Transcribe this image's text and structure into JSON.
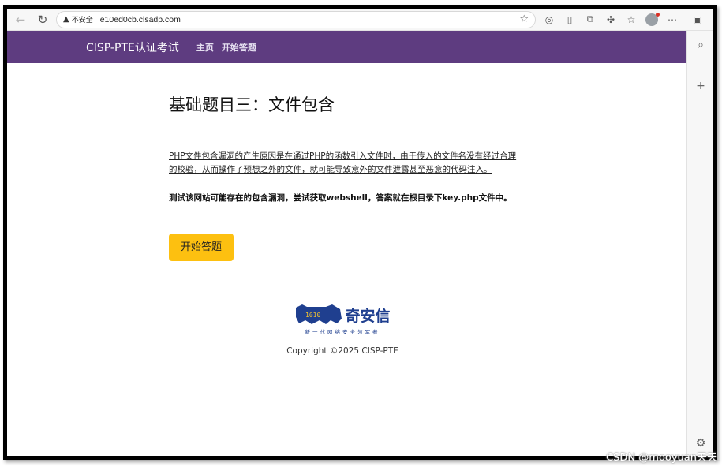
{
  "browser": {
    "security_label": "不安全",
    "url": "e10ed0cb.clsadp.com"
  },
  "site": {
    "brand": "CISP-PTE认证考试",
    "nav": [
      {
        "label": "主页"
      },
      {
        "label": "开始答题"
      }
    ]
  },
  "main": {
    "title": "基础题目三：文件包含",
    "intro": "PHP文件包含漏洞的产生原因是在通过PHP的函数引入文件时，由于传入的文件名没有经过合理的校验，从而操作了预想之外的文件，就可能导致意外的文件泄露甚至恶意的代码注入。",
    "task": "测试该网站可能存在的包含漏洞，尝试获取webshell，答案就在根目录下key.php文件中。",
    "start_button": "开始答题"
  },
  "footer": {
    "logo_text": "奇安信",
    "logo_slogan": "新一代网络安全领军者",
    "copyright": "Copyright ©2025 CISP-PTE"
  },
  "watermark": "CSDN @mooyuan天天",
  "colors": {
    "nav_bg": "#5e3c80",
    "button_bg": "#fdc010",
    "logo_blue": "#1f3f8f"
  }
}
